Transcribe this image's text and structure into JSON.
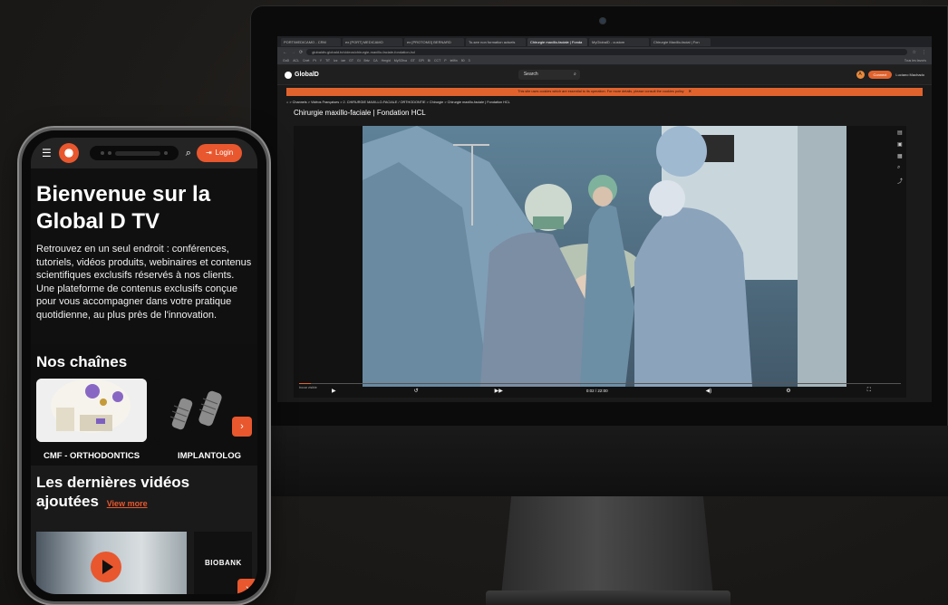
{
  "colors": {
    "accent": "#e8572e",
    "background": "#1d1b19",
    "phone_bg": "#0f0f0f",
    "cookie_bar": "#e0632e"
  },
  "desktop": {
    "tabs": [
      "PORT/MEDICAMO - CRM",
      "ex [PORT] MEDICAMO",
      "ex [PROTOMO] BERNARD",
      "To-see non formation actuels",
      "Chirurgie maxillo-faciale | Fonda",
      "MyGlobalD - custom",
      "Chirurgie Maxillo-facial | Fon"
    ],
    "url": "globaldtv.globald.tv/videos/chirurgie-maxillo-faciale-fondation-hcl",
    "bookmarks": [
      "GoD",
      "ACL",
      "Cnet",
      "Pt",
      "Y",
      "TiT",
      "Izz",
      "iae",
      "GT",
      "Gi",
      "Brtz",
      "CA",
      "Hmgid",
      "MySOlva",
      "GT",
      "GPI",
      "Bi",
      "CCT",
      "P",
      "tellfin",
      "50",
      "3"
    ],
    "bookmarks_right": "Tous les favoris",
    "site": {
      "logo": "GlobalD",
      "search_placeholder": "Search",
      "connect_label": "Connect",
      "user_name": "Luciano Machado",
      "badge_icon": "A"
    },
    "cookie_text": "This site uses cookies which are essential to its operation. For more details, please consult the cookies policy",
    "breadcrumb": "⌂  >  Channels  >  Vidéos Françaises  >  2. CHIRURGIE MAXILLO-FACIALE / ORTHODONTIE  >  Chirurgie  >  Chirurgie maxillo-faciale | Fondation HCL",
    "video_title": "Chirurgie maxillo-faciale | Fondation HCL",
    "player": {
      "label": "trocar visible",
      "time": "0:02 / 22:00",
      "progress": 0.02
    }
  },
  "phone": {
    "login_label": "Login",
    "hero_title": "Bienvenue sur la Global D TV",
    "hero_text": "Retrouvez en un seul endroit : conférences, tutoriels, vidéos produits, webinaires et contenus scientifiques exclusifs réservés à nos clients. Une plateforme de contenus exclusifs conçue pour vous accompagner dans votre pratique quotidienne, au plus près de l'innovation.",
    "channels_title": "Nos chaînes",
    "channels": [
      "CMF - ORTHODONTICS",
      "IMPLANTOLOG"
    ],
    "latest_title": "Les dernières vidéos ajoutées",
    "view_more": "View more",
    "video2_text": "BIOBANK"
  }
}
